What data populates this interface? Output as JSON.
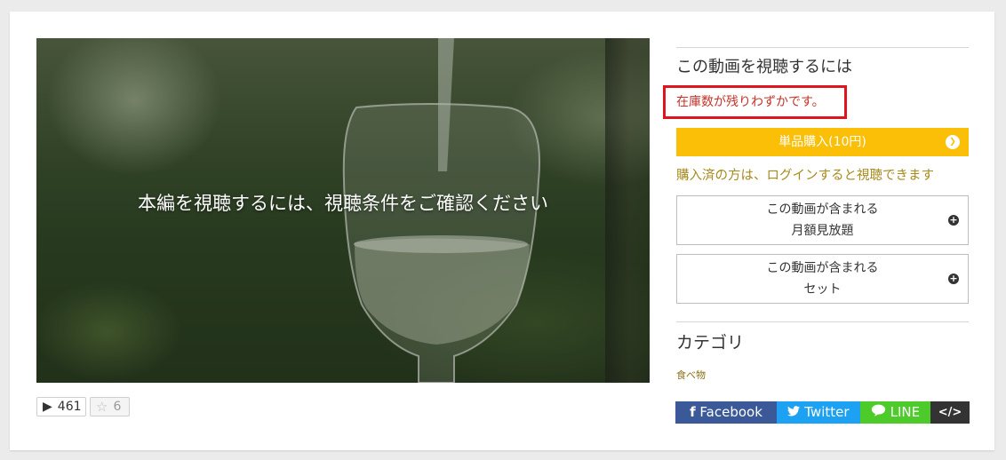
{
  "video": {
    "overlay_text": "本編を視聴するには、視聴条件をご確認ください"
  },
  "stats": {
    "view_icon": "▶",
    "views": "461",
    "fav_icon": "☆",
    "favorites": "6"
  },
  "purchase": {
    "section_title": "この動画を視聴するには",
    "stock_notice": "在庫数が残りわずかです。",
    "buy_button": "単品購入(10円)",
    "login_note": "購入済の方は、ログインすると視聴できます",
    "subscription_line1": "この動画が含まれる",
    "subscription_line2": "月額見放題",
    "set_line1": "この動画が含まれる",
    "set_line2": "セット"
  },
  "category": {
    "title": "カテゴリ",
    "item": "食べ物"
  },
  "share": {
    "facebook_icon": "f",
    "facebook": "Facebook",
    "twitter": "Twitter",
    "line": "LINE",
    "embed": "</>"
  },
  "colors": {
    "buy_button": "#fbbf07",
    "stock_notice_border": "#e0141e",
    "facebook": "#3b5998",
    "twitter": "#1da1f2",
    "line": "#4ccb2b",
    "embed": "#333333"
  }
}
